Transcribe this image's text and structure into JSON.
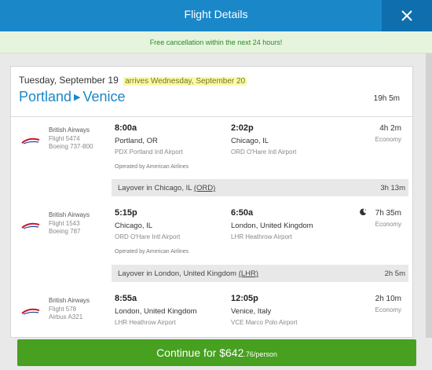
{
  "header": {
    "title": "Flight Details",
    "close_icon": "close-icon",
    "color": "#1a87c9"
  },
  "banner": {
    "text": "Free cancellation within the next 24 hours!"
  },
  "trip": {
    "date": "Tuesday, September 19",
    "arrives": "arrives Wednesday, September 20",
    "origin": "Portland",
    "destination": "Venice",
    "duration": "19h 5m"
  },
  "segments": [
    {
      "airline": "British Airways",
      "flight": "Flight 5474",
      "aircraft": "Boeing 737-800",
      "dep_time": "8:00a",
      "dep_city": "Portland, OR",
      "dep_airport": "PDX Portland Intl Airport",
      "arr_time": "2:02p",
      "arr_city": "Chicago, IL",
      "arr_airport": "ORD O'Hare Intl Airport",
      "duration": "4h 2m",
      "cabin": "Economy",
      "operated_by": "Operated by American Airlines"
    },
    {
      "airline": "British Airways",
      "flight": "Flight 1543",
      "aircraft": "Boeing 787",
      "dep_time": "5:15p",
      "dep_city": "Chicago, IL",
      "dep_airport": "ORD O'Hare Intl Airport",
      "arr_time": "6:50a",
      "arr_city": "London, United Kingdom",
      "arr_airport": "LHR Heathrow Airport",
      "duration": "7h 35m",
      "cabin": "Economy",
      "operated_by": "Operated by American Airlines",
      "overnight_icon": "moon-icon"
    },
    {
      "airline": "British Airways",
      "flight": "Flight 578",
      "aircraft": "Airbus A321",
      "dep_time": "8:55a",
      "dep_city": "London, United Kingdom",
      "dep_airport": "LHR Heathrow Airport",
      "arr_time": "12:05p",
      "arr_city": "Venice, Italy",
      "arr_airport": "VCE Marco Polo Airport",
      "duration": "2h 10m",
      "cabin": "Economy"
    }
  ],
  "layovers": [
    {
      "label": "Layover in Chicago, IL",
      "code": "(ORD)",
      "time": "3h 13m"
    },
    {
      "label": "Layover in London, United Kingdom",
      "code": "(LHR)",
      "time": "2h 5m"
    }
  ],
  "continue": {
    "label": "Continue for ",
    "price": "$642",
    "cents": ".76",
    "per": "/person",
    "color": "#47a020"
  }
}
